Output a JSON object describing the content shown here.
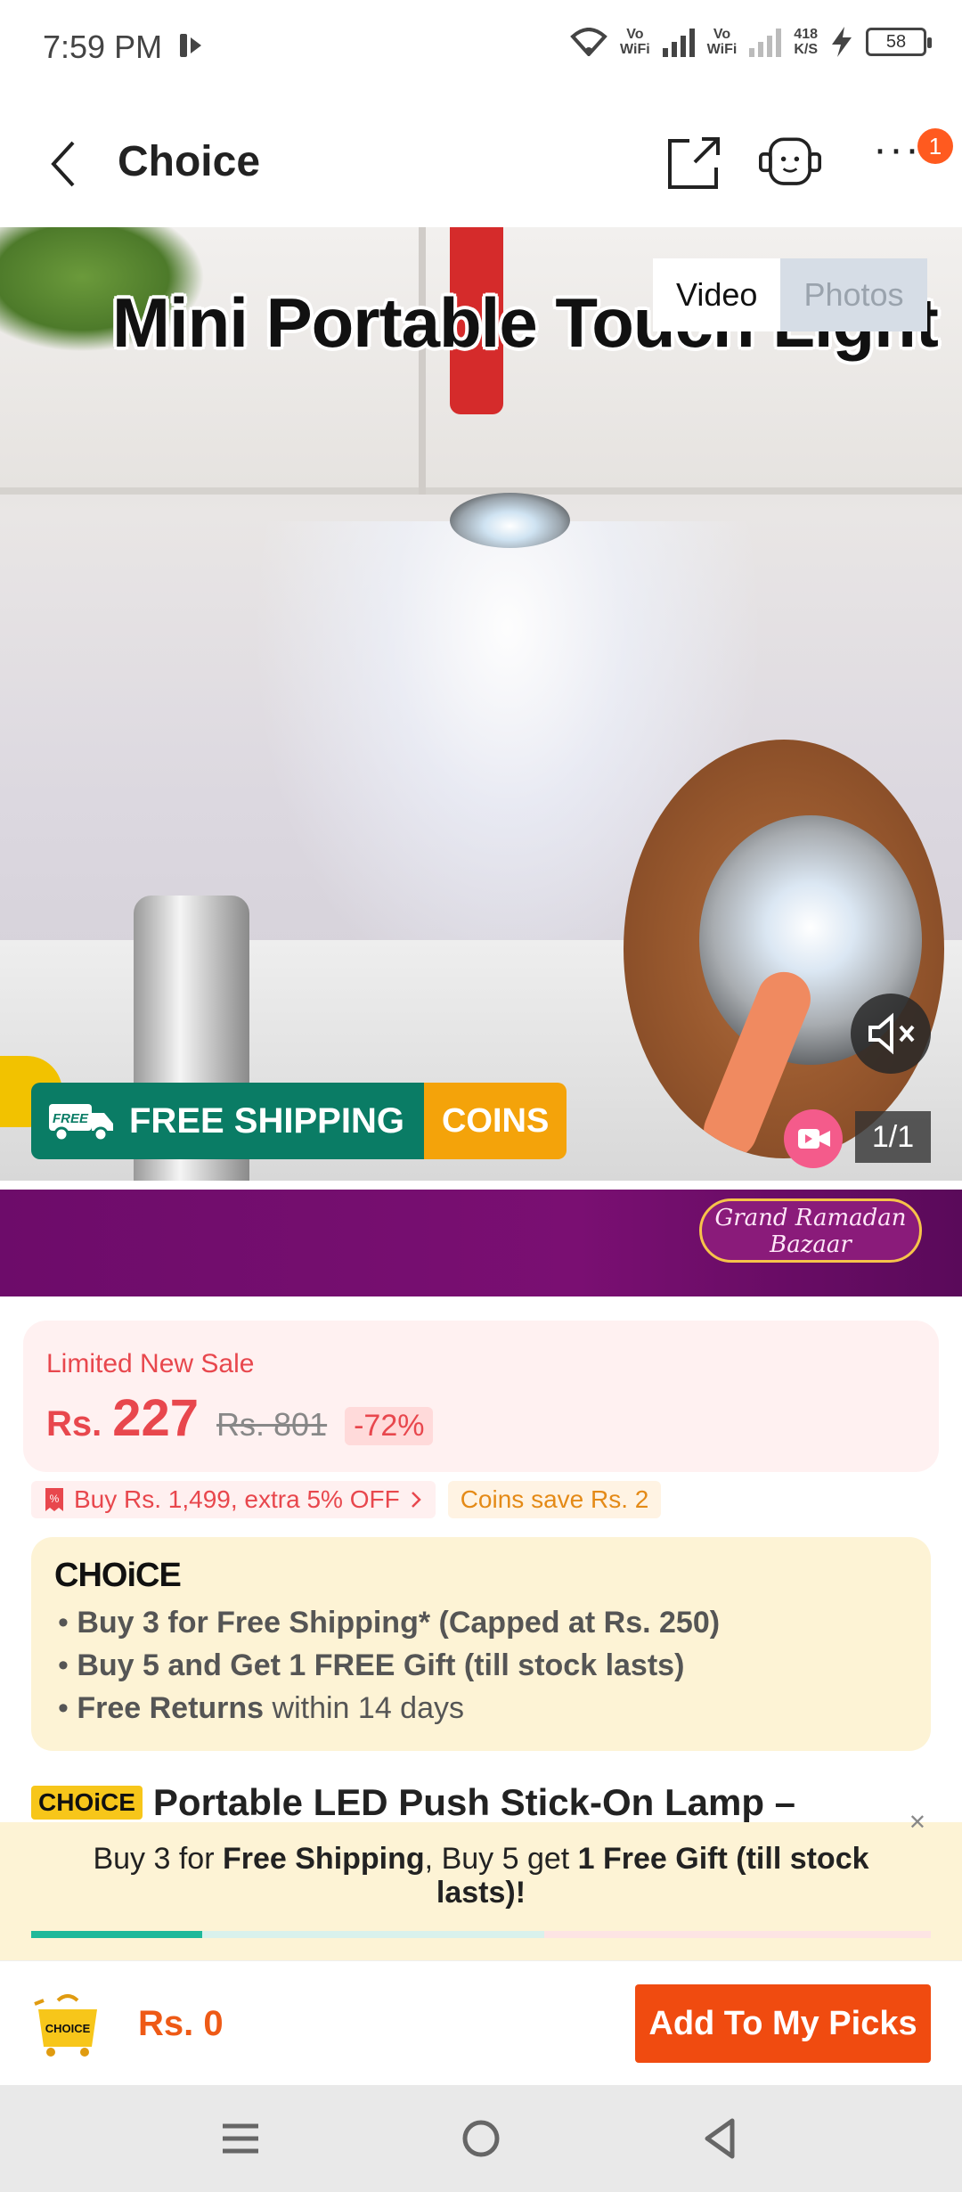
{
  "status_bar": {
    "time": "7:59 PM",
    "net1": "Vo\nWiFi",
    "net2": "Vo\nWiFi",
    "speed_value": "418",
    "speed_unit": "K/S",
    "battery": "58"
  },
  "header": {
    "title": "Choice",
    "notification_count": "1"
  },
  "media": {
    "headline": "Mini Portable Touch Light",
    "tabs": [
      "Video",
      "Photos"
    ],
    "shipping_label": "FREE SHIPPING",
    "truck_label": "FREE",
    "coins_label": "COINS",
    "counter": "1/1"
  },
  "ramadan_banner": {
    "line1": "Grand Ramadan",
    "line2": "Bazaar"
  },
  "price": {
    "label": "Limited New Sale",
    "currency": "Rs.",
    "current": "227",
    "original": "Rs. 801",
    "discount": "-72%"
  },
  "promos": {
    "extra_off": "Buy Rs. 1,499, extra 5% OFF",
    "coins_save": "Coins save Rs. 2"
  },
  "choice_card": {
    "logo": "CHOiCE",
    "items": [
      {
        "bold": "Buy 3 for  Free Shipping* (Capped at Rs. 250)",
        "rest": ""
      },
      {
        "bold": "Buy 5 and Get 1 FREE Gift (till stock lasts)",
        "rest": ""
      },
      {
        "bold": "Free Returns",
        "rest": " within 14 days"
      }
    ]
  },
  "product": {
    "badge": "CHOiCE",
    "title": "Portable LED Push Stick-On Lamp –"
  },
  "promo_banner": {
    "part1": "Buy 3 for ",
    "part2": "Free Shipping",
    "part3": ", Buy 5 get ",
    "part4": "1 Free Gift (till stock lasts)!",
    "progress_filled": 0.19,
    "progress_mid": 0.57
  },
  "action_bar": {
    "cart_label": "CHOICE",
    "total": "Rs. 0",
    "add_button": "Add To My Picks"
  },
  "colors": {
    "accent": "#f04b10",
    "price": "#e8474d",
    "shipping_green": "#0a7c65",
    "coins_orange": "#f4a30a",
    "ramadan_purple": "#6d0c6a"
  }
}
